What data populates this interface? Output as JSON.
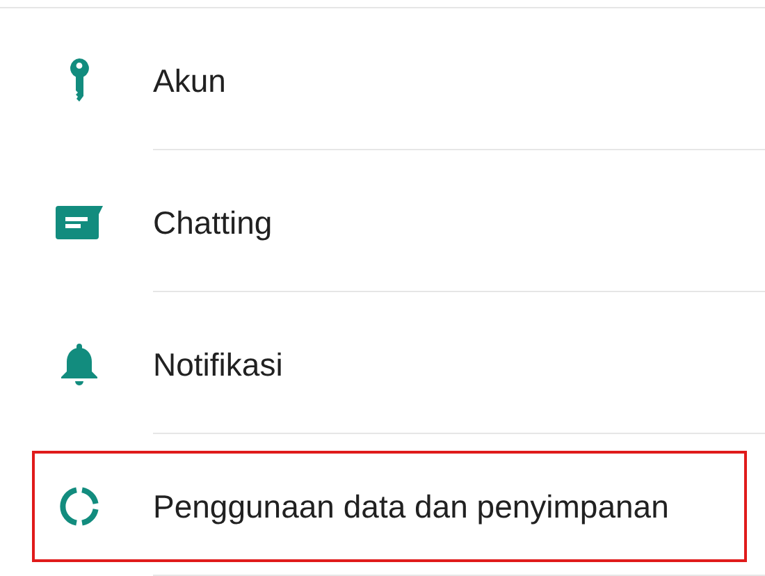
{
  "settings_items": [
    {
      "kind": "key",
      "label": "Akun",
      "highlighted": false
    },
    {
      "kind": "chat",
      "label": "Chatting",
      "highlighted": false
    },
    {
      "kind": "bell",
      "label": "Notifikasi",
      "highlighted": false
    },
    {
      "kind": "data",
      "label": "Penggunaan data dan penyimpanan",
      "highlighted": true
    }
  ]
}
